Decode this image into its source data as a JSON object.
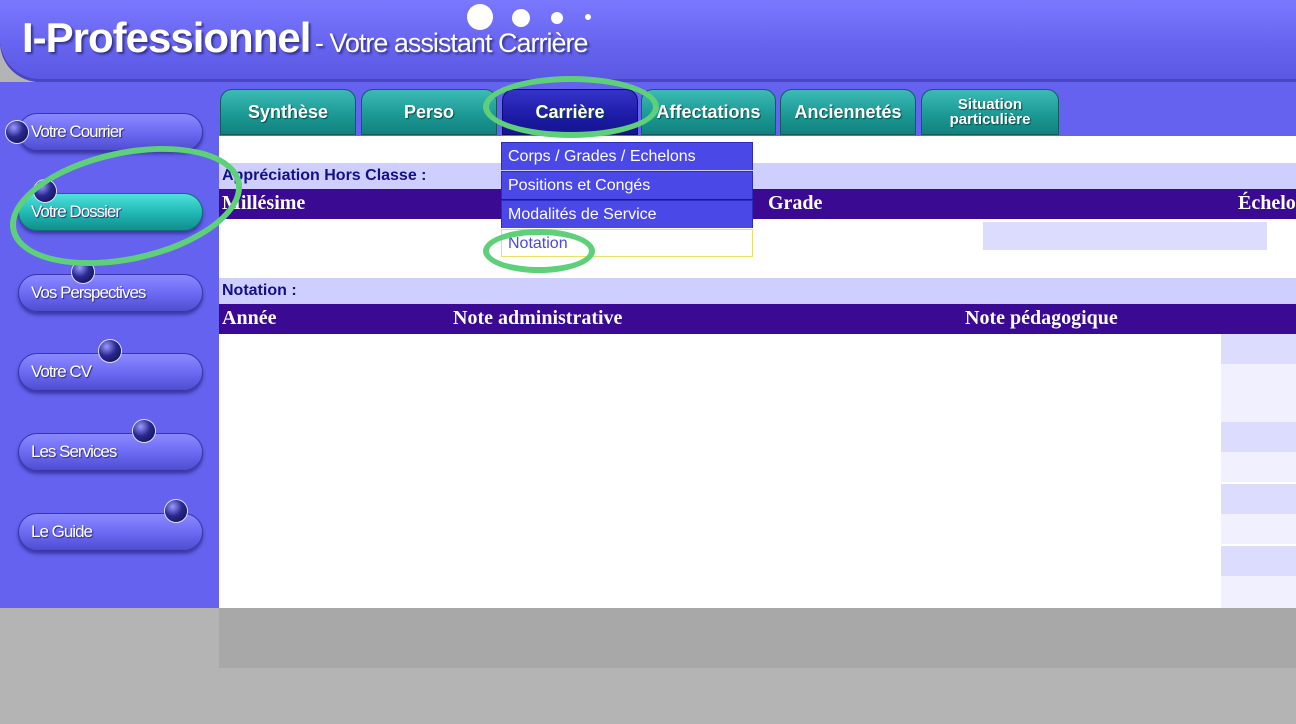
{
  "header": {
    "brand": "I-Professionnel",
    "subtitle": "- Votre assistant Carrière"
  },
  "sidebar": {
    "items": [
      {
        "label": "Votre Courrier",
        "active": false
      },
      {
        "label": "Votre Dossier",
        "active": true
      },
      {
        "label": "Vos Perspectives",
        "active": false
      },
      {
        "label": "Votre CV",
        "active": false
      },
      {
        "label": "Les Services",
        "active": false
      },
      {
        "label": "Le Guide",
        "active": false
      }
    ]
  },
  "tabs": [
    {
      "label": "Synthèse"
    },
    {
      "label": "Perso"
    },
    {
      "label": "Carrière",
      "active": true
    },
    {
      "label": "Affectations"
    },
    {
      "label": "Anciennetés"
    },
    {
      "label": "Situation particulière",
      "line1": "Situation",
      "line2": "particulière"
    }
  ],
  "dropdown": {
    "items": [
      "Corps / Grades / Echelons",
      "Positions et Congés",
      "Modalités de Service",
      "Notation"
    ]
  },
  "sections": {
    "appreciation": {
      "label": "Appréciation Hors Classe :",
      "columns": [
        "Millésime",
        "Grade",
        "Échelo"
      ]
    },
    "notation": {
      "label": "Notation :",
      "columns": [
        "Année",
        "Note administrative",
        "Note pédagogique"
      ]
    }
  },
  "colors": {
    "header": "#6563ee",
    "tab": "#1a9792",
    "tab_active": "#1c1ba6",
    "table_head": "#3a0a92",
    "section_label": "#cfcfff",
    "highlight": "#5fd07a"
  }
}
